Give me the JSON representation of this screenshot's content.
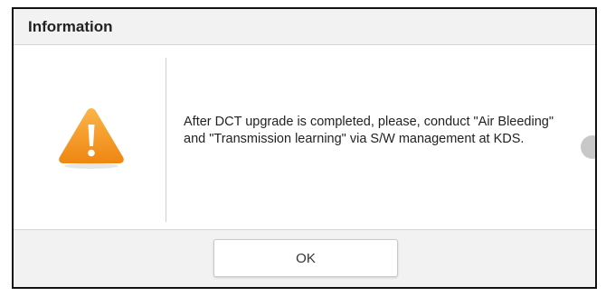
{
  "dialog": {
    "title": "Information",
    "icon": "warning-icon",
    "message": "After DCT upgrade is completed, please, conduct \"Air Bleeding\" and \"Transmission learning\" via S/W management at KDS.",
    "ok_label": "OK"
  },
  "colors": {
    "warning_orange": "#f39a1e",
    "header_bg": "#f2f2f2",
    "text": "#222222"
  }
}
